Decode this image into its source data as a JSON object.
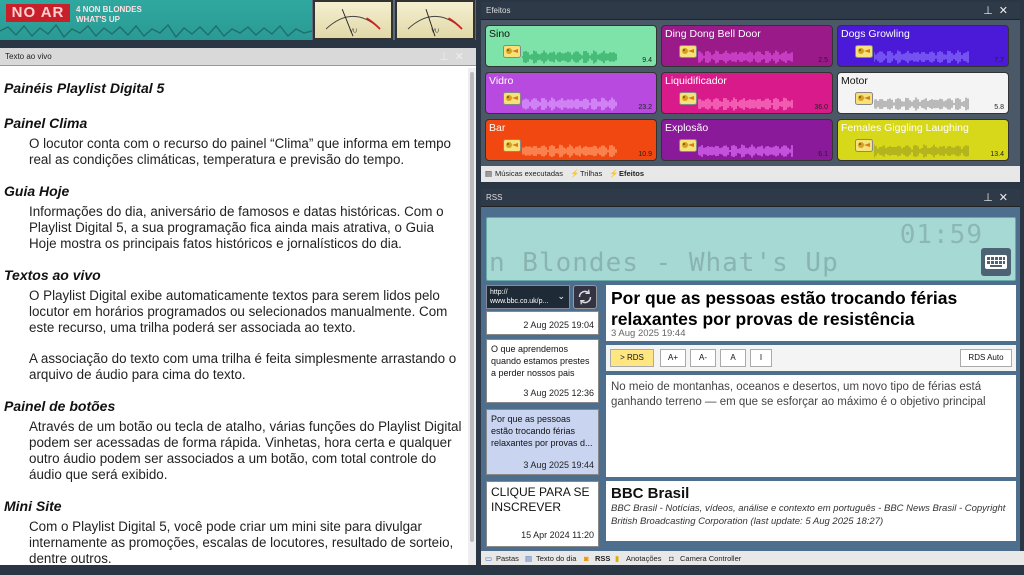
{
  "now_playing": {
    "on_air": "NO AR",
    "line1": "4 NON BLONDES",
    "line2": "WHAT'S UP"
  },
  "vu": {
    "left_label": "VU",
    "right_label": "VU"
  },
  "text_panel": {
    "title": "Texto ao vivo",
    "heading": "Painéis Playlist Digital 5",
    "sections": [
      {
        "h": "Painel Clima",
        "p": [
          "O locutor conta com o recurso do painel “Clima” que informa em tempo real as condições climáticas, temperatura e previsão do tempo."
        ]
      },
      {
        "h": "Guia Hoje",
        "p": [
          "Informações do dia, aniversário de famosos e datas históricas. Com o Playlist Digital 5, a sua programação fica ainda mais atrativa, o Guia Hoje mostra os principais fatos históricos e jornalísticos do dia."
        ]
      },
      {
        "h": "Textos ao vivo",
        "p": [
          "O Playlist Digital exibe automaticamente textos para serem lidos pelo locutor em horários programados ou selecionados manualmente. Com este recurso, uma trilha poderá ser associada ao texto.",
          "A associação do texto com uma trilha é feita simplesmente arrastando o arquivo de áudio para cima do texto."
        ]
      },
      {
        "h": "Painel de botões",
        "p": [
          "Através de um botão ou tecla de atalho, várias funções do Playlist Digital podem ser acessadas de forma rápida. Vinhetas, hora certa e qualquer outro áudio podem ser associados a um botão, com total controle do áudio que será exibido."
        ]
      },
      {
        "h": "Mini Site",
        "p": [
          "Com o Playlist Digital 5, você pode criar um mini site para divulgar internamente as promoções, escalas de locutores, resultado de sorteio, dentre outros."
        ]
      }
    ]
  },
  "efeitos": {
    "title": "Efeitos",
    "pads": [
      {
        "name": "Sino",
        "value": "9.4",
        "bg": "#7ee3a8",
        "fg": "#111",
        "wave": "#2aa860"
      },
      {
        "name": "Ding Dong Bell Door",
        "value": "2.5",
        "bg": "#9a1a8a",
        "fg": "#fff",
        "wave": "#e050e0"
      },
      {
        "name": "Dogs Growling",
        "value": "7.7",
        "bg": "#4a1ad8",
        "fg": "#fff",
        "wave": "#8a70ff"
      },
      {
        "name": "Vidro",
        "value": "23.2",
        "bg": "#b84ae0",
        "fg": "#fff",
        "wave": "#dca0ff"
      },
      {
        "name": "Liquidificador",
        "value": "36.0",
        "bg": "#d81a8a",
        "fg": "#fff",
        "wave": "#ff80c8"
      },
      {
        "name": "Motor",
        "value": "5.8",
        "bg": "#f4f4f4",
        "fg": "#111",
        "wave": "#999"
      },
      {
        "name": "Bar",
        "value": "10.9",
        "bg": "#f04810",
        "fg": "#fff",
        "wave": "#ffa070"
      },
      {
        "name": "Explosão",
        "value": "6.1",
        "bg": "#8a1a9a",
        "fg": "#fff",
        "wave": "#e070ff"
      },
      {
        "name": "Females Giggling Laughing",
        "value": "13.4",
        "bg": "#d8d81a",
        "fg": "#fff",
        "wave": "#a0a020"
      }
    ],
    "tabs": [
      "Músicas executadas",
      "Trilhas",
      "Efeitos"
    ]
  },
  "rss": {
    "title": "RSS",
    "clock": "01:59",
    "marquee": "n Blondes - What's Up",
    "url": "http://\nwww.bbc.co.uk/p...",
    "items": [
      {
        "text": "",
        "date": "2 Aug 2025 19:04"
      },
      {
        "text": "O que aprendemos quando estamos prestes a perder nossos pais",
        "date": "3 Aug 2025 12:36"
      },
      {
        "text": "Por que as pessoas estão trocando férias relaxantes por provas d...",
        "date": "3 Aug 2025 19:44"
      },
      {
        "text": "CLIQUE PARA SE INSCREVER",
        "date": "15 Apr 2024 11:20"
      }
    ],
    "article": {
      "title": "Por que as pessoas estão trocando férias relaxantes por provas de resistência",
      "date": "3 Aug 2025 19:44",
      "buttons": [
        "> RDS",
        "A+",
        "A-",
        "A",
        "I",
        "RDS Auto"
      ],
      "description": "No meio de montanhas, oceanos e desertos, um novo tipo de férias está ganhando terreno — em que se esforçar ao máximo é o objetivo principal"
    },
    "feed": {
      "title": "BBC Brasil",
      "subtitle": "BBC Brasil - Notícias, vídeos, análise e contexto em português - BBC News Brasil - Copyright British Broadcasting Corporation  (last update: 5 Aug 2025 18:27)"
    }
  },
  "bottom_tabs": [
    "Pastas",
    "Texto do dia",
    "RSS",
    "Anotações",
    "Camera Controller"
  ]
}
